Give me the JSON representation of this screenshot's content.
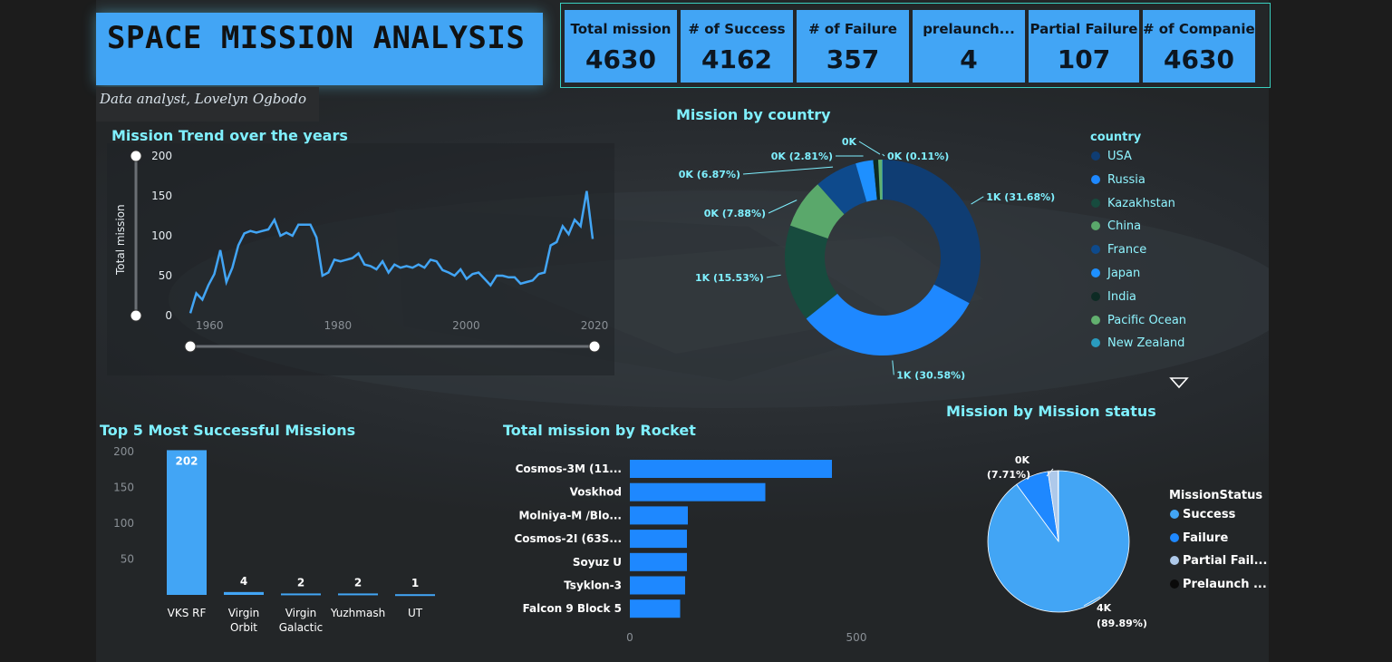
{
  "header": {
    "title": "SPACE MISSION ANALYSIS",
    "subtitle": "Data analyst, Lovelyn Ogbodo"
  },
  "kpis": [
    {
      "label": "Total mission",
      "value": "4630"
    },
    {
      "label": "# of Success",
      "value": "4162"
    },
    {
      "label": "# of Failure",
      "value": "357"
    },
    {
      "label": "prelaunch...",
      "value": "4"
    },
    {
      "label": "Partial Failure",
      "value": "107"
    },
    {
      "label": "# of Companies",
      "value": "4630"
    }
  ],
  "colors": {
    "accent": "#42a5f5",
    "title_teal": "#7ff0ff",
    "bar_blue": "#1e88ff",
    "background": "#202020"
  },
  "chart_data": [
    {
      "type": "line",
      "title": "Mission Trend over the years",
      "xlabel": "",
      "ylabel": "Total mission",
      "xlim": [
        1957,
        2020
      ],
      "ylim": [
        0,
        200
      ],
      "x_ticks": [
        "1960",
        "1980",
        "2000",
        "2020"
      ],
      "y_ticks": [
        "0",
        "50",
        "100",
        "150",
        "200"
      ],
      "x": [
        1957,
        1958,
        1959,
        1960,
        1961,
        1962,
        1963,
        1964,
        1965,
        1966,
        1967,
        1968,
        1969,
        1970,
        1971,
        1972,
        1973,
        1974,
        1975,
        1976,
        1977,
        1978,
        1979,
        1980,
        1981,
        1982,
        1983,
        1984,
        1985,
        1986,
        1987,
        1988,
        1989,
        1990,
        1991,
        1992,
        1993,
        1994,
        1995,
        1996,
        1997,
        1998,
        1999,
        2000,
        2001,
        2002,
        2003,
        2004,
        2005,
        2006,
        2007,
        2008,
        2009,
        2010,
        2011,
        2012,
        2013,
        2014,
        2015,
        2016,
        2017,
        2018,
        2019,
        2020
      ],
      "values": [
        3,
        28,
        20,
        38,
        52,
        82,
        42,
        60,
        88,
        103,
        106,
        104,
        106,
        108,
        120,
        100,
        104,
        100,
        114,
        114,
        114,
        98,
        50,
        54,
        70,
        68,
        70,
        72,
        78,
        64,
        62,
        58,
        68,
        54,
        64,
        60,
        62,
        60,
        64,
        60,
        70,
        68,
        57,
        54,
        50,
        58,
        46,
        52,
        54,
        46,
        38,
        50,
        50,
        48,
        48,
        40,
        42,
        44,
        52,
        54,
        88,
        92,
        112,
        102,
        120,
        112,
        156,
        96
      ]
    },
    {
      "type": "pie",
      "title": "Mission by country",
      "legend_title": "country",
      "categories": [
        "USA",
        "Russia",
        "Kazakhstan",
        "China",
        "France",
        "Japan",
        "India",
        "Pacific Ocean",
        "New Zealand"
      ],
      "values": [
        31.68,
        30.58,
        15.53,
        7.88,
        6.87,
        2.81,
        0.8,
        0.6,
        0.11
      ],
      "labels": [
        "1K (31.68%)",
        "1K (30.58%)",
        "1K (15.53%)",
        "0K (7.88%)",
        "0K (6.87%)",
        "0K (2.81%)",
        "",
        "0K",
        "0K (0.11%)"
      ],
      "colors": [
        "#0f3d73",
        "#1e88ff",
        "#174b3e",
        "#5aa86b",
        "#0e4a8c",
        "#1e90ff",
        "#0d2b24",
        "#62b06f",
        "#2a9bbf"
      ],
      "legend": "right"
    },
    {
      "type": "bar",
      "title": "Top 5 Most Successful Missions",
      "categories": [
        "VKS RF",
        "Virgin Orbit",
        "Virgin Galactic",
        "Yuzhmash",
        "UT"
      ],
      "values": [
        202,
        4,
        2,
        2,
        1
      ],
      "y_ticks": [
        "50",
        "100",
        "150",
        "200"
      ],
      "ylim": [
        0,
        200
      ]
    },
    {
      "type": "bar",
      "orientation": "horizontal",
      "title": "Total mission by Rocket",
      "categories": [
        "Cosmos-3M (11...",
        "Voskhod",
        "Molniya-M /Blo...",
        "Cosmos-2I (63S...",
        "Soyuz U",
        "Tsyklon-3",
        "Falcon 9 Block 5"
      ],
      "values": [
        446,
        299,
        128,
        126,
        126,
        122,
        111
      ],
      "x_ticks": [
        "0",
        "500"
      ],
      "xlim": [
        0,
        500
      ]
    },
    {
      "type": "pie",
      "title": "Mission by Mission status",
      "legend_title": "MissionStatus",
      "categories": [
        "Success",
        "Failure",
        "Partial Fail...",
        "Prelaunch ..."
      ],
      "values": [
        89.89,
        7.71,
        2.31,
        0.09
      ],
      "labels": [
        "4K (89.89%)",
        "0K (7.71%)",
        "",
        ""
      ],
      "colors": [
        "#42a5f5",
        "#1e88ff",
        "#aec9ea",
        "#0a0a0a"
      ],
      "legend": "right"
    }
  ]
}
